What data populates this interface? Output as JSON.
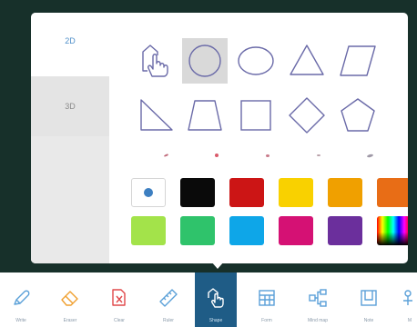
{
  "panel": {
    "tabs": [
      {
        "label": "2D",
        "selected": true
      },
      {
        "label": "3D",
        "selected": false
      }
    ],
    "shapes_row1": [
      {
        "icon": "hand-shape-icon",
        "selected": false
      },
      {
        "icon": "circle-icon",
        "selected": true
      },
      {
        "icon": "ellipse-icon",
        "selected": false
      },
      {
        "icon": "triangle-icon",
        "selected": false
      },
      {
        "icon": "parallelogram-icon",
        "selected": false
      }
    ],
    "shapes_row2": [
      {
        "icon": "right-triangle-icon"
      },
      {
        "icon": "trapezoid-icon"
      },
      {
        "icon": "square-icon"
      },
      {
        "icon": "diamond-icon"
      },
      {
        "icon": "pentagon-icon"
      }
    ],
    "line_widths": [
      "extra-thin",
      "thin",
      "medium",
      "thick",
      "extra-thick"
    ],
    "colors_row1": [
      "#ffffff",
      "#0a0a0a",
      "#cc1515",
      "#f9d100",
      "#f0a000",
      "#e86d16"
    ],
    "colors_row2": [
      "#a3e34a",
      "#2fc36b",
      "#0ea6e8",
      "#d51174",
      "#6b2f9c",
      "spectrum"
    ],
    "accent": "#1f5c86"
  },
  "toolbar": {
    "tools": [
      {
        "label": "Write",
        "icon": "pen-icon",
        "active": false
      },
      {
        "label": "Eraser",
        "icon": "eraser-icon",
        "active": false
      },
      {
        "label": "Clear",
        "icon": "clear-icon",
        "active": false
      },
      {
        "label": "Ruler",
        "icon": "ruler-icon",
        "active": false
      },
      {
        "label": "Shape",
        "icon": "shape-icon",
        "active": true
      },
      {
        "label": "Form",
        "icon": "table-icon",
        "active": false
      },
      {
        "label": "Mind map",
        "icon": "mind-map-icon",
        "active": false
      },
      {
        "label": "Note",
        "icon": "note-icon",
        "active": false
      },
      {
        "label": "M",
        "icon": "more-icon",
        "active": false
      }
    ]
  }
}
